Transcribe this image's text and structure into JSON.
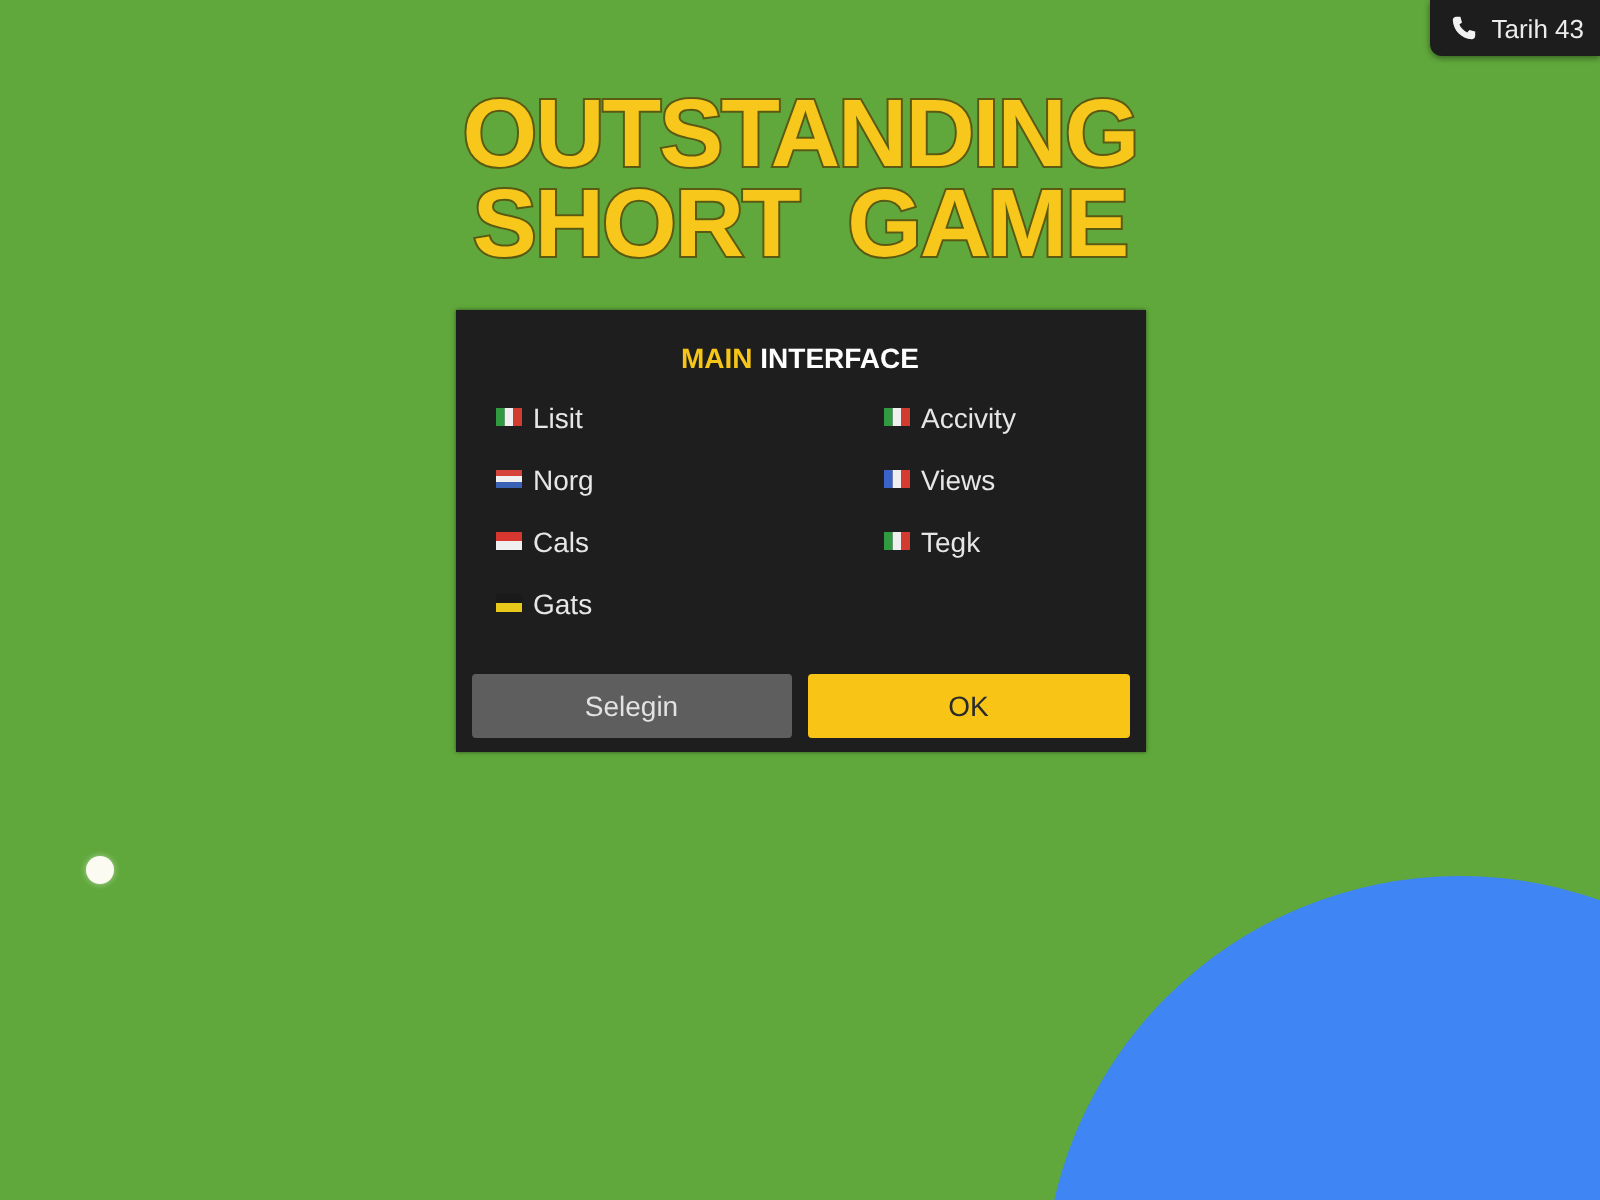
{
  "corner_badge": {
    "label": "Tarih 43"
  },
  "title": "OUTSTANDING SHORT GAME",
  "panel": {
    "heading": {
      "highlight": "MAIN",
      "text": "INTERFACE"
    },
    "items": [
      {
        "label": "Lisit",
        "flag": {
          "kind": "vertical",
          "stripes": [
            {
              "color": "#2f9a3f"
            },
            {
              "color": "#f0f0f0"
            },
            {
              "color": "#d23b2f"
            }
          ]
        }
      },
      {
        "label": "Accivity",
        "flag": {
          "kind": "vertical",
          "stripes": [
            {
              "color": "#2f9a3f"
            },
            {
              "color": "#f0f0f0"
            },
            {
              "color": "#d23b2f"
            }
          ]
        }
      },
      {
        "label": "Norg",
        "flag": {
          "kind": "horizontal",
          "stripes": [
            {
              "color": "#d5433b"
            },
            {
              "color": "#f0f0f0"
            },
            {
              "color": "#3a62b5"
            }
          ]
        }
      },
      {
        "label": "Views",
        "flag": {
          "kind": "vertical",
          "stripes": [
            {
              "color": "#3a62c8"
            },
            {
              "color": "#f0f0f0"
            },
            {
              "color": "#d63b32"
            }
          ]
        }
      },
      {
        "label": "Cals",
        "flag": {
          "kind": "horizontal",
          "stripes": [
            {
              "color": "#d8372f"
            },
            {
              "color": "#f0f0f0"
            }
          ]
        }
      },
      {
        "label": "Tegk",
        "flag": {
          "kind": "vertical",
          "stripes": [
            {
              "color": "#2f9a3f"
            },
            {
              "color": "#f0f0f0"
            },
            {
              "color": "#d23b2f"
            }
          ]
        }
      },
      {
        "label": "Gats",
        "flag": {
          "kind": "horizontal",
          "stripes": [
            {
              "color": "#1a1a1a"
            },
            {
              "color": "#e8c81a"
            }
          ]
        }
      }
    ],
    "buttons": [
      {
        "label": "Selegin",
        "kind": "secondary"
      },
      {
        "label": "OK",
        "kind": "primary"
      }
    ]
  }
}
